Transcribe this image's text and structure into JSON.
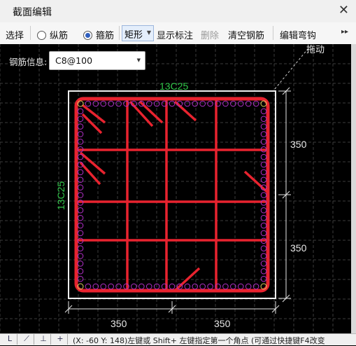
{
  "window": {
    "title": "截面编辑",
    "close_glyph": "✕"
  },
  "toolbar": {
    "select": "选择",
    "longitudinal": "纵筋",
    "stirrup": "箍筋",
    "shape": "矩形",
    "show_dims": "显示标注",
    "delete": "删除",
    "clear": "清空钢筋",
    "edit_hook": "编辑弯钩",
    "more_glyph": "▸▸"
  },
  "rebar_info": {
    "label": "钢筋信息:",
    "value": "C8@100"
  },
  "canvas": {
    "top_right_text": "拖动",
    "top_bar_label": "13C25",
    "left_bar_label": "13C25",
    "dim_right_top": "350",
    "dim_right_bottom": "350",
    "dim_bottom_left": "350",
    "dim_bottom_right": "350"
  },
  "statusbar": {
    "buttons": [
      "L",
      "⟋",
      "⊥",
      "+"
    ],
    "text": "(X: -60 Y: 148)左键或 Shift+ 左键指定第一个角点 (可通过快捷键F4改变"
  },
  "colors": {
    "stirrup": "#e8232f",
    "bar": "#b22fc8",
    "dim": "#e6e6e6",
    "label": "#31c84a",
    "grid": "#4a4a4a"
  }
}
